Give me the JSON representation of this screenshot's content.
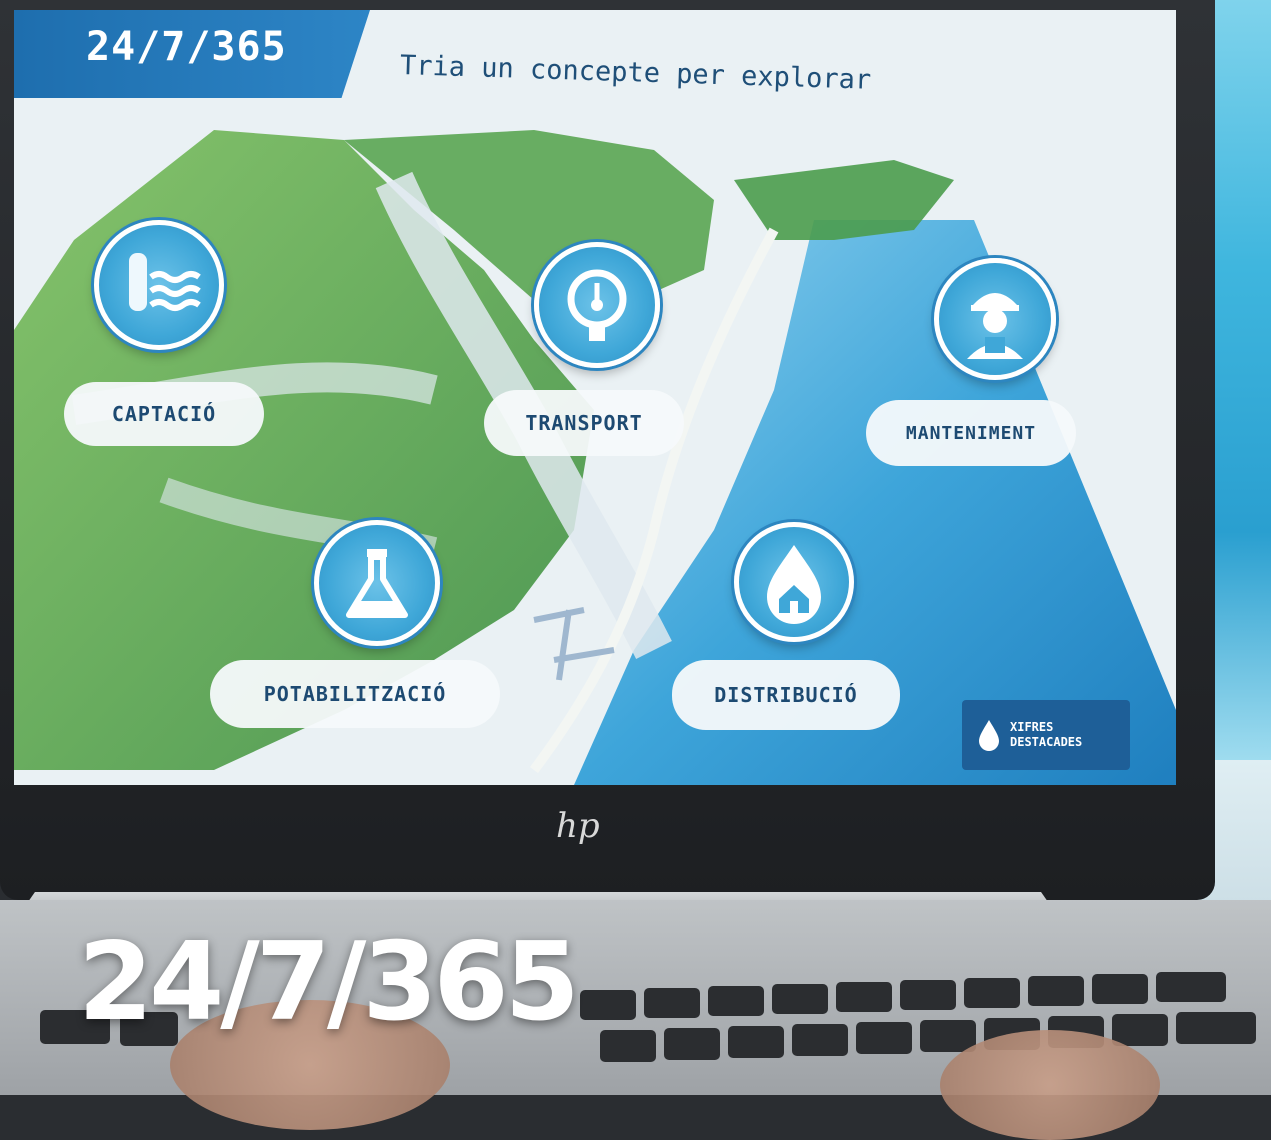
{
  "screen": {
    "title_tab": "24/7/365",
    "subtitle": "Tria un concepte per explorar",
    "concepts": [
      {
        "id": "captacio",
        "label": "CAPTACIÓ",
        "icon": "water-tower-waves-icon"
      },
      {
        "id": "transport",
        "label": "TRANSPORT",
        "icon": "pressure-gauge-icon"
      },
      {
        "id": "manteniment",
        "label": "MANTENIMENT",
        "icon": "worker-icon"
      },
      {
        "id": "potabilitzacio",
        "label": "POTABILITZACIÓ",
        "icon": "lab-flask-icon"
      },
      {
        "id": "distribucio",
        "label": "DISTRIBUCIÓ",
        "icon": "water-drop-house-icon"
      }
    ],
    "xifres_button": {
      "line1": "XIFRES",
      "line2": "DESTACADES",
      "icon": "water-drop-icon"
    }
  },
  "laptop": {
    "brand_logo": "hp"
  },
  "overlay": {
    "title": "24/7/365"
  },
  "colors": {
    "accent_blue": "#2d85c6",
    "dark_blue": "#1e5f98",
    "label_text": "#1d4a72",
    "land_green": "#4f9e4a",
    "sea_blue": "#3ea5da"
  }
}
